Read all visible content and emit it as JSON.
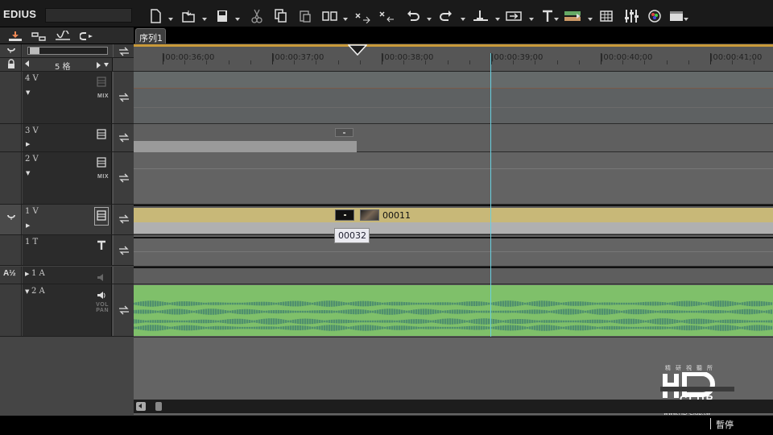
{
  "app": {
    "title": "EDIUS"
  },
  "sequence": {
    "tab_label": "序列1"
  },
  "scale": {
    "label": "5 格"
  },
  "ruler": {
    "labels": [
      "|00:00:36;00",
      "|00:00:37;00",
      "|00:00:38;00",
      "|00:00:39;00",
      "|00:00:40;00",
      "|00:00:41;00"
    ]
  },
  "tracks": [
    {
      "name": "4 V",
      "mix": "MIX"
    },
    {
      "name": "3 V"
    },
    {
      "name": "2 V",
      "mix": "MIX"
    },
    {
      "name": "1 V"
    },
    {
      "name": "1 T"
    },
    {
      "name": "1 A"
    },
    {
      "name": "2 A",
      "vol": "VOL",
      "pan": "PAN"
    }
  ],
  "clips": {
    "v1_clip_name": "00011"
  },
  "tooltip": {
    "text": "00032"
  },
  "status": {
    "text": "暫停"
  },
  "watermark": {
    "logo": "HD CLUB",
    "site": "www.HD-Club.tw",
    "top": "精研視聽所"
  },
  "colors": {
    "clip_video": "#c8b878",
    "clip_audio": "#7fc06a",
    "playhead": "#6ad0e0",
    "ruler_accent": "#c99a3a"
  }
}
